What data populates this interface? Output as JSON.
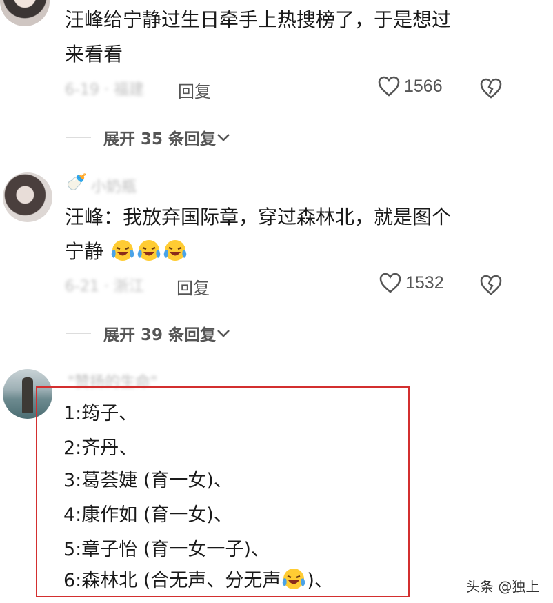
{
  "comments": [
    {
      "text_line1": "汪峰给宁静过生日牵手上热搜榜了，于是想过",
      "text_line2": "来看看",
      "meta": "6-19 · 福建",
      "reply_label": "回复",
      "likes": "1566",
      "expand_label": "展开 35 条回复"
    },
    {
      "username": "小奶瓶",
      "text_line1": "汪峰：我放弃国际章，穿过森林北，就是图个",
      "text_line2": "宁静",
      "meta": "6-21 · 浙江",
      "reply_label": "回复",
      "likes": "1532",
      "expand_label": "展开 39 条回复"
    },
    {
      "username": "\"赞扬的生命\"",
      "list": [
        "1:筠子、",
        "2:齐丹、",
        "3:葛荟婕 (育一女)、",
        "4:康作如 (育一女)、",
        "5:章子怡 (育一女一子)、",
        "6:森林北 (合无声、分无声",
        ")、"
      ]
    }
  ],
  "watermark": "头条 @独上",
  "colors": {
    "highlight_border": "#d32f2f",
    "meta_gray": "#c2c2c2",
    "action_gray": "#555555"
  },
  "icons": {
    "like": "heart-outline-icon",
    "dislike": "broken-heart-icon",
    "expand": "chevron-down-icon",
    "emoji": "laughing-tears-emoji"
  }
}
